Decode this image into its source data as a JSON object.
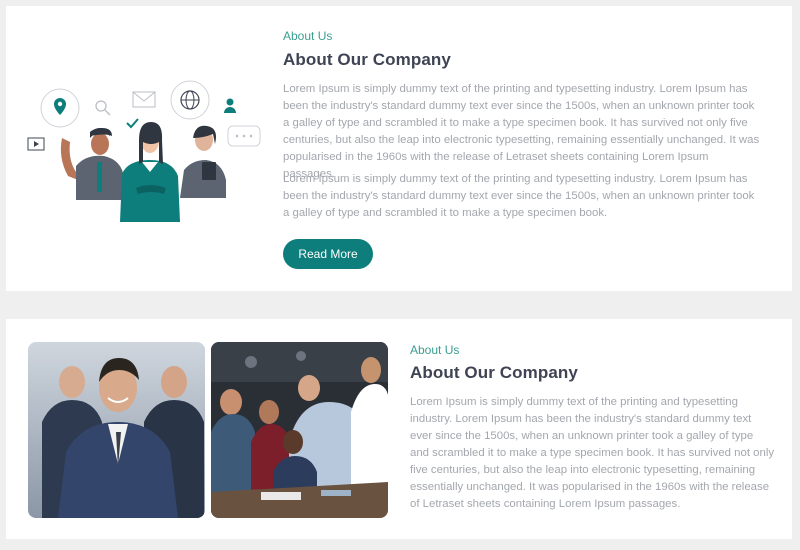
{
  "section1": {
    "kicker": "About Us",
    "title": "About Our Company",
    "paragraphs": [
      "Lorem Ipsum is simply dummy text of the printing and typesetting industry. Lorem Ipsum has been the industry's standard dummy text ever since the 1500s, when an unknown printer took a galley of type and scrambled it to make a type specimen book. It has survived not only five centuries, but also the leap into electronic typesetting, remaining essentially unchanged. It was popularised in the 1960s with the release of Letraset sheets containing Lorem Ipsum passages.",
      "Lorem Ipsum is simply dummy text of the printing and typesetting industry. Lorem Ipsum has been the industry's standard dummy text ever since the 1500s, when an unknown printer took a galley of type and scrambled it to make a type specimen book."
    ],
    "button_label": "Read More"
  },
  "section2": {
    "kicker": "About Us",
    "title": "About Our Company",
    "paragraph": "Lorem Ipsum is simply dummy text of the printing and typesetting industry. Lorem Ipsum has been the industry's standard dummy text ever since the 1500s, when an unknown printer took a galley of type and scrambled it to make a type specimen book. It has survived not only five centuries, but also the leap into electronic typesetting, remaining essentially unchanged. It was popularised in the 1960s with the release of Letraset sheets containing Lorem Ipsum passages."
  },
  "colors": {
    "page_background": "#efefef",
    "card_background": "#ffffff",
    "accent_teal": "#0d7e7b",
    "kicker_teal": "#3a9e92",
    "heading": "#3e4453",
    "body_text": "#a3a7ad"
  },
  "icons": [
    "location-pin-icon",
    "search-icon",
    "mail-icon",
    "globe-icon",
    "user-icon",
    "check-icon",
    "chat-bubble-icon",
    "video-play-icon"
  ]
}
